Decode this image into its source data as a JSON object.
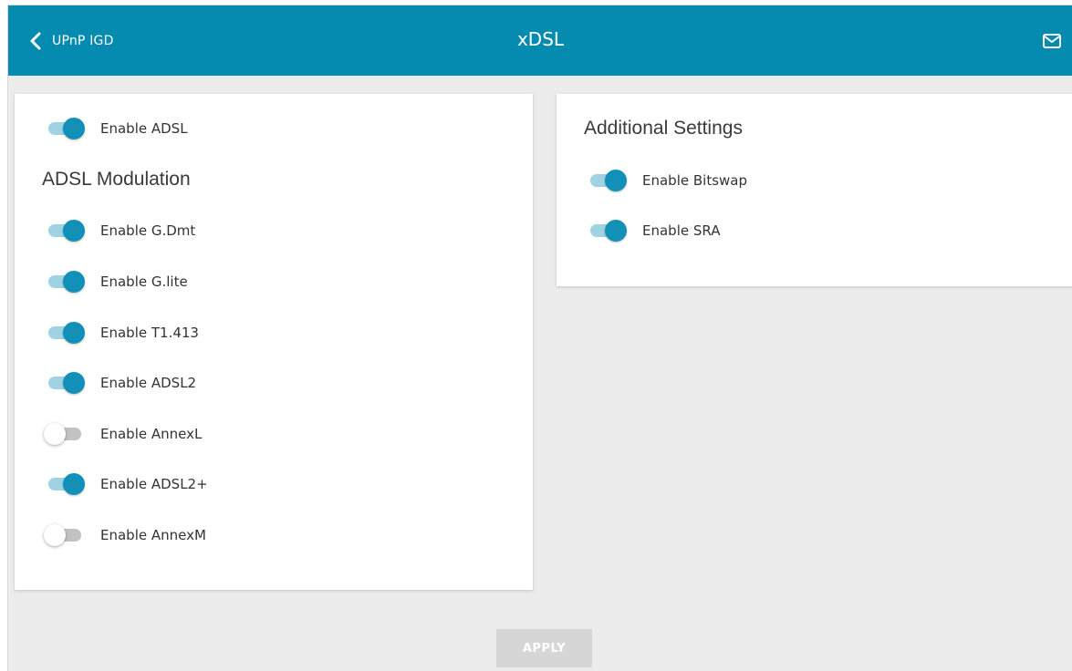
{
  "header": {
    "back_label": "UPnP IGD",
    "title": "xDSL",
    "accent_color": "#058ab0"
  },
  "left_card": {
    "enable_adsl": {
      "label": "Enable ADSL",
      "on": true
    },
    "section_title": "ADSL Modulation",
    "modulations": [
      {
        "label": "Enable G.Dmt",
        "on": true
      },
      {
        "label": "Enable G.lite",
        "on": true
      },
      {
        "label": "Enable T1.413",
        "on": true
      },
      {
        "label": "Enable ADSL2",
        "on": true
      },
      {
        "label": "Enable AnnexL",
        "on": false
      },
      {
        "label": "Enable ADSL2+",
        "on": true
      },
      {
        "label": "Enable AnnexM",
        "on": false
      }
    ]
  },
  "right_card": {
    "section_title": "Additional Settings",
    "options": [
      {
        "label": "Enable Bitswap",
        "on": true
      },
      {
        "label": "Enable SRA",
        "on": true
      }
    ]
  },
  "footer": {
    "apply_label": "APPLY"
  },
  "icons": {
    "back": "chevron-left-icon",
    "mail": "mail-icon"
  }
}
